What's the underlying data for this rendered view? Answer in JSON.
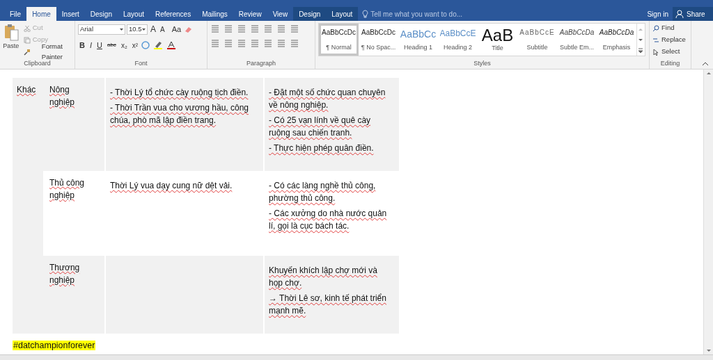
{
  "tabs": [
    {
      "label": "File",
      "selected": false,
      "kind": "main"
    },
    {
      "label": "Home",
      "selected": true,
      "kind": "main"
    },
    {
      "label": "Insert",
      "selected": false,
      "kind": "main"
    },
    {
      "label": "Design",
      "selected": false,
      "kind": "main"
    },
    {
      "label": "Layout",
      "selected": false,
      "kind": "main"
    },
    {
      "label": "References",
      "selected": false,
      "kind": "main"
    },
    {
      "label": "Mailings",
      "selected": false,
      "kind": "main"
    },
    {
      "label": "Review",
      "selected": false,
      "kind": "main"
    },
    {
      "label": "View",
      "selected": false,
      "kind": "main"
    },
    {
      "label": "Design",
      "selected": false,
      "kind": "context"
    },
    {
      "label": "Layout",
      "selected": false,
      "kind": "context"
    }
  ],
  "tell_me": {
    "placeholder": "Tell me what you want to do..."
  },
  "sign_in": "Sign in",
  "share": "Share",
  "clipboard": {
    "paste": "Paste",
    "cut": "Cut",
    "copy": "Copy",
    "format_painter": "Format Painter",
    "label": "Clipboard"
  },
  "font": {
    "font_name": "Arial",
    "font_size": "10.5",
    "size_buttons": [
      "A",
      "A",
      "Aa"
    ],
    "format_buttons": [
      "B",
      "I",
      "U",
      "abc",
      "x₂",
      "x²"
    ],
    "label": "Font"
  },
  "paragraph": {
    "label": "Paragraph"
  },
  "styles": {
    "label": "Styles",
    "items": [
      {
        "preview": "AaBbCcDc",
        "label": "¶ Normal",
        "kind": "normal",
        "selected": true
      },
      {
        "preview": "AaBbCcDc",
        "label": "¶ No Spac...",
        "kind": "nospacing",
        "selected": false
      },
      {
        "preview": "AaBbCc",
        "label": "Heading 1",
        "kind": "heading1",
        "selected": false
      },
      {
        "preview": "AaBbCcE",
        "label": "Heading 2",
        "kind": "heading2",
        "selected": false
      },
      {
        "preview": "AaB",
        "label": "Title",
        "kind": "title",
        "selected": false
      },
      {
        "preview": "AaBbCcE",
        "label": "Subtitle",
        "kind": "subtitle",
        "selected": false
      },
      {
        "preview": "AaBbCcDa",
        "label": "Subtle Em...",
        "kind": "subtle",
        "selected": false
      },
      {
        "preview": "AaBbCcDa",
        "label": "Emphasis",
        "kind": "emphasis",
        "selected": false
      }
    ]
  },
  "editing": {
    "find": "Find",
    "replace": "Replace",
    "select": "Select",
    "label": "Editing"
  },
  "table": {
    "column_1": "Khác",
    "rows": [
      {
        "shaded": true,
        "column_2": "Nông nghiệp",
        "column_3": [
          "- Thời Lý tổ chức cày ruộng tịch điền.",
          "- Thời Trần vua cho vương hầu, công chúa, phò mã lập điền trang."
        ],
        "column_4": [
          "- Đặt một số chức quan chuyên về nông nghiệp.",
          "- Có 25 vạn lính về quê cày ruộng sau chiến tranh.",
          "- Thực hiện phép quân điền."
        ]
      },
      {
        "shaded": false,
        "column_2": "Thủ công nghiệp",
        "column_3": [
          "Thời Lý vua dạy cung nữ dệt vải."
        ],
        "column_4": [
          "- Có các làng nghề thủ công, phường thủ công.",
          "- Các xưởng do nhà nước quản lí, gọi là cục bách tác."
        ]
      },
      {
        "shaded": true,
        "column_2": "Thương nghiệp",
        "column_3": [],
        "column_4": [
          "Khuyến khích lập chợ mới và họp chợ.",
          "→ Thời Lê sơ, kinh tế phát triển mạnh mẽ."
        ]
      }
    ]
  },
  "hashtag": "#datchampionforever"
}
